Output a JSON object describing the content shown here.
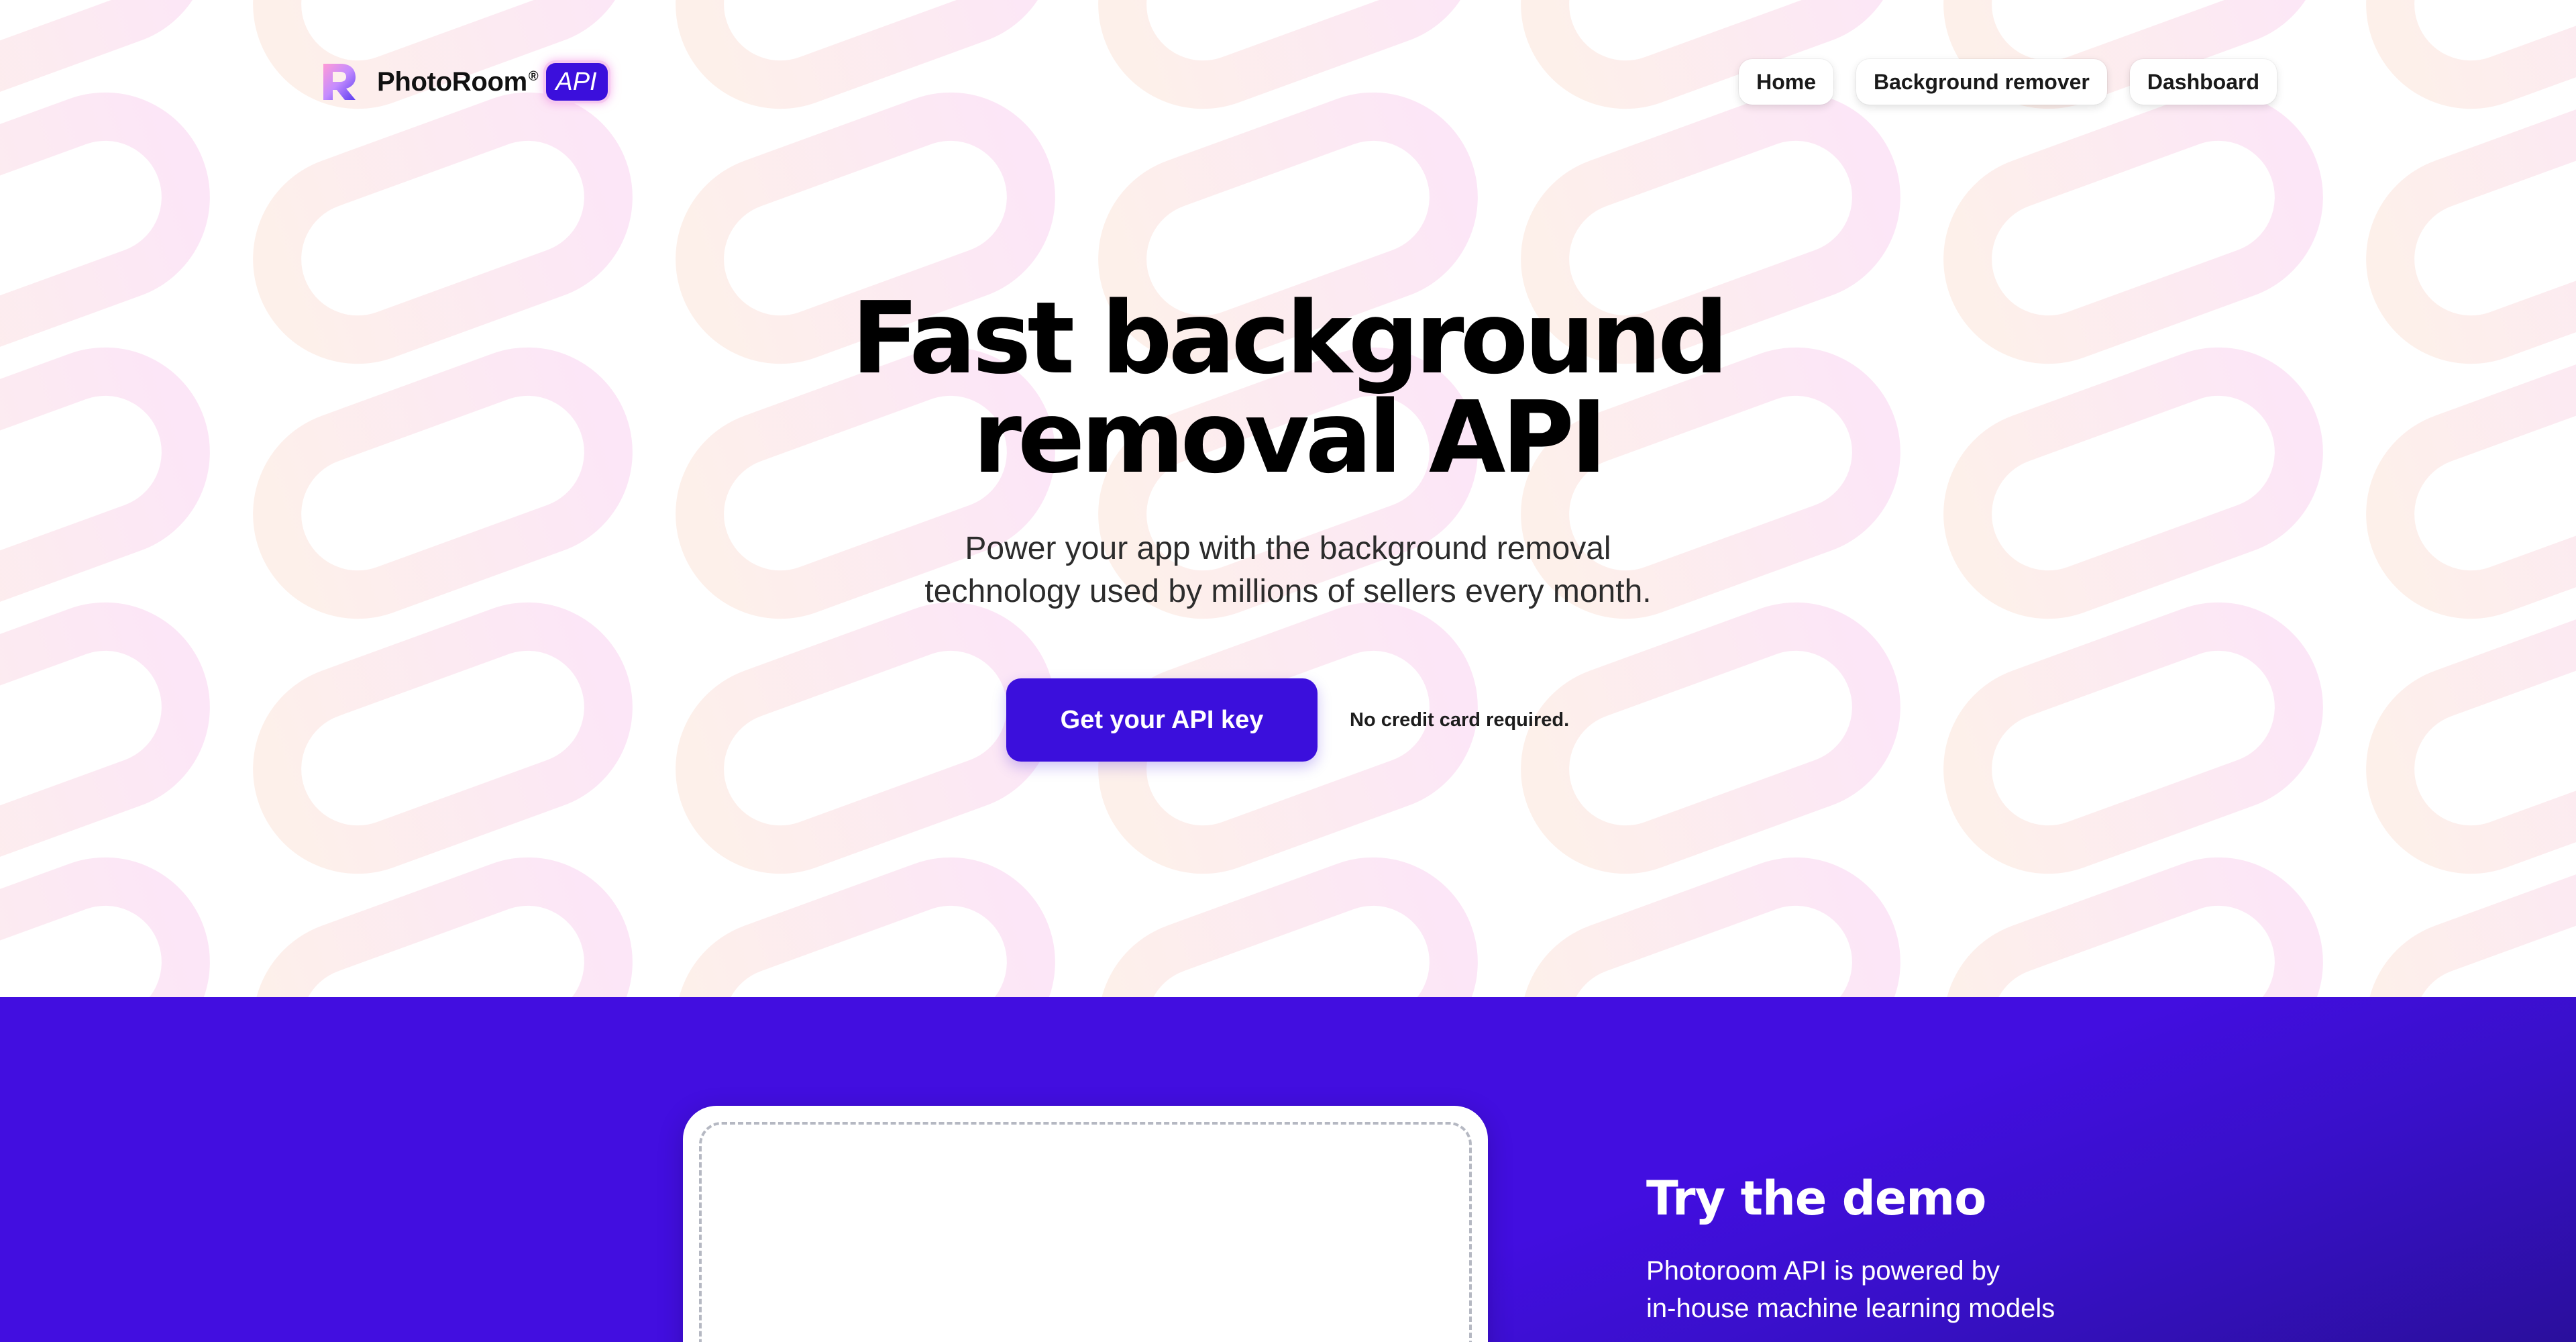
{
  "brand": {
    "name": "PhotoRoom",
    "registered": "®",
    "badge": "API"
  },
  "nav": {
    "items": [
      {
        "label": "Home"
      },
      {
        "label": "Background remover"
      },
      {
        "label": "Dashboard"
      }
    ]
  },
  "hero": {
    "title_line1": "Fast background",
    "title_line2": "removal API",
    "subtitle_line1": "Power your app with the background removal",
    "subtitle_line2": "technology used by millions of sellers every month.",
    "cta_label": "Get your API key",
    "cta_note": "No credit card required."
  },
  "demo": {
    "title": "Try the demo",
    "desc_line1": "Photoroom API is powered by",
    "desc_line2": "in-house machine learning models"
  },
  "colors": {
    "accent": "#3b0fdc",
    "demo_bg": "#420ee0",
    "pattern_pink": "#fce8f6",
    "pattern_peach": "#fdf0ea"
  },
  "icons": {
    "logo": "photoroom-r-logo-icon"
  }
}
